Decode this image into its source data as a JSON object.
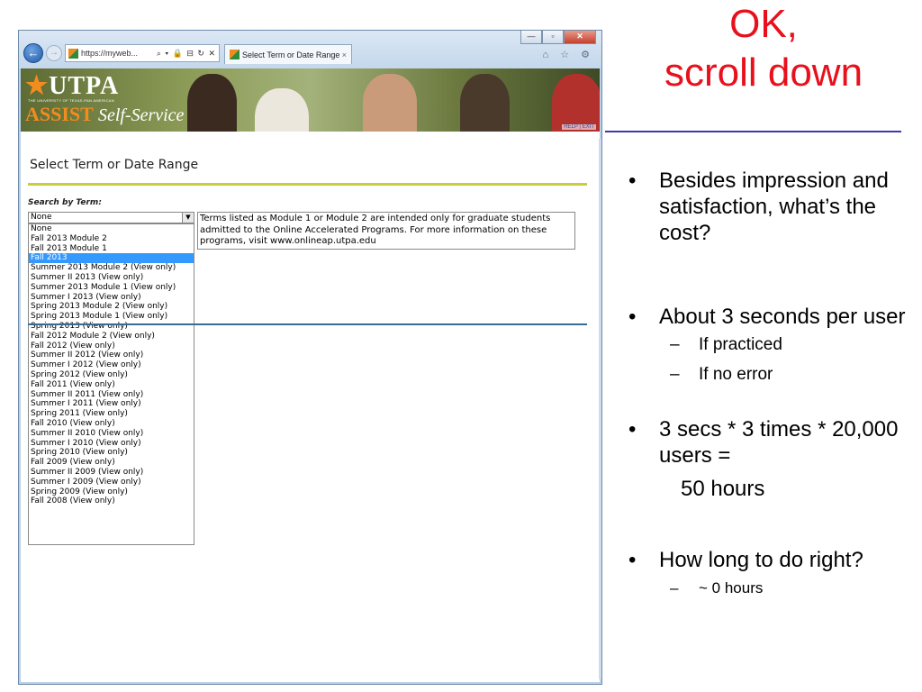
{
  "browser": {
    "address_text": "https://myweb...",
    "address_controls": "⌕ ▾ 🔒 ⊟ ↻ ✕",
    "tab_title": "Select Term or Date Range",
    "tab_close": "×",
    "window_controls": [
      "—",
      "▫",
      "✕"
    ],
    "right_icons": "⌂ ☆ ⚙"
  },
  "banner": {
    "logo_main": "UTPA",
    "logo_star": "★",
    "tagline": "THE UNIVERSITY OF TEXAS-PAN AMERICAN",
    "logo_assist": "ASSIST",
    "logo_selfservice": "Self-Service",
    "help_link": "HELP | EXIT"
  },
  "page": {
    "title": "Select Term or Date Range",
    "search_label": "Search by Term:",
    "select_value": "None",
    "select_arrow": "▼",
    "options": [
      "None",
      "Fall 2013 Module 2",
      "Fall 2013 Module 1",
      "Fall 2013",
      "Summer 2013 Module 2 (View only)",
      "Summer II 2013 (View only)",
      "Summer 2013 Module 1 (View only)",
      "Summer I 2013 (View only)",
      "Spring 2013 Module 2 (View only)",
      "Spring 2013 Module 1 (View only)",
      "Spring 2013 (View only)",
      "Fall 2012 Module 2 (View only)",
      "Fall 2012 (View only)",
      "Summer II 2012 (View only)",
      "Summer I 2012 (View only)",
      "Spring 2012 (View only)",
      "Fall 2011 (View only)",
      "Summer II 2011 (View only)",
      "Summer I 2011 (View only)",
      "Spring 2011 (View only)",
      "Fall 2010 (View only)",
      "Summer II 2010 (View only)",
      "Summer I 2010 (View only)",
      "Spring 2010 (View only)",
      "Fall 2009 (View only)",
      "Summer II 2009 (View only)",
      "Summer I 2009 (View only)",
      "Spring 2009 (View only)",
      "Fall 2008 (View only)"
    ],
    "highlighted_option": "Fall 2013",
    "note": "Terms listed as Module 1 or Module 2 are intended only for graduate students admitted to the Online Accelerated Programs. For more information on these programs, visit www.onlineap.utpa.edu"
  },
  "slide": {
    "heading_line1": "OK,",
    "heading_line2": "scroll down",
    "bullet_char": "•",
    "dash_char": "–",
    "bullets": {
      "b1": "Besides impression and satisfaction, what’s the cost?",
      "b2": "About 3 seconds per user",
      "b2_sub1": "If practiced",
      "b2_sub2": "If no error",
      "b3": "3 secs * 3 times * 20,000 users =",
      "b3_cont": "50 hours",
      "b4": "How long to do right?",
      "b4_sub1": "~ 0 hours"
    }
  },
  "colors": {
    "heading_red": "#e8101c",
    "highlight_blue": "#3399ff",
    "utpa_orange": "#f28c1e"
  }
}
